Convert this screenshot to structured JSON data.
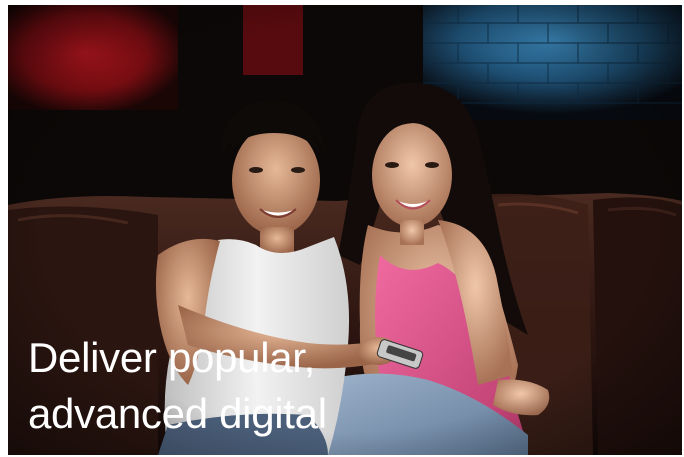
{
  "caption": {
    "line1": "Deliver popular,",
    "line2": "advanced digital"
  },
  "colors": {
    "background": "#0c0807",
    "red_wall": "#a5141c",
    "blue_brick": "#2a6e9a",
    "couch": "#3a1d16",
    "top": "#e8558f",
    "tank": "#e9e9e9",
    "text": "#ffffff"
  },
  "scene": {
    "description_icons": [
      "couple-on-couch",
      "tv-remote-icon"
    ]
  }
}
